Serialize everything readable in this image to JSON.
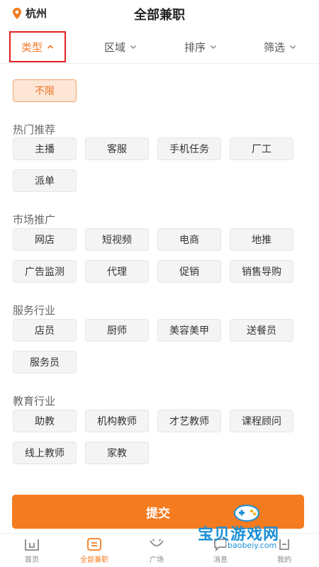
{
  "header": {
    "city": "杭州",
    "title": "全部兼职"
  },
  "filters": [
    {
      "label": "类型",
      "active": true
    },
    {
      "label": "区域",
      "active": false
    },
    {
      "label": "排序",
      "active": false
    },
    {
      "label": "筛选",
      "active": false
    }
  ],
  "unlimited": "不限",
  "sections": [
    {
      "title": "热门推荐",
      "items": [
        "主播",
        "客服",
        "手机任务",
        "厂工",
        "派单"
      ]
    },
    {
      "title": "市场推广",
      "items": [
        "网店",
        "短视频",
        "电商",
        "地推",
        "广告监测",
        "代理",
        "促销",
        "销售导购"
      ]
    },
    {
      "title": "服务行业",
      "items": [
        "店员",
        "厨师",
        "美容美甲",
        "送餐员",
        "服务员"
      ]
    },
    {
      "title": "教育行业",
      "items": [
        "助教",
        "机构教师",
        "才艺教师",
        "课程顾问",
        "线上教师",
        "家教"
      ]
    }
  ],
  "submit": "提交",
  "tabbar": [
    {
      "label": "首页",
      "icon": "home-icon",
      "active": false
    },
    {
      "label": "全部兼职",
      "icon": "jobs-icon",
      "active": true
    },
    {
      "label": "广场",
      "icon": "plaza-icon",
      "active": false
    },
    {
      "label": "消息",
      "icon": "message-icon",
      "active": false
    },
    {
      "label": "我的",
      "icon": "profile-icon",
      "active": false
    }
  ],
  "watermark": {
    "name": "宝贝游戏网",
    "url": "baobeiy.com"
  },
  "colors": {
    "accent": "#f47b20",
    "highlight_box": "#e02020",
    "chip_bg": "#f4f4f4"
  }
}
